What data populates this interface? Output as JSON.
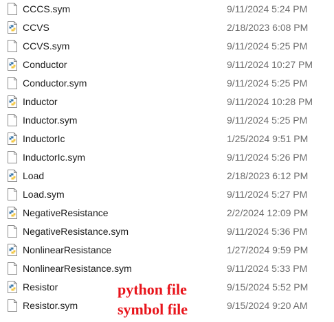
{
  "files": [
    {
      "name": "CCCS.sym",
      "modified": "9/11/2024 5:24 PM",
      "icon": "document-icon"
    },
    {
      "name": "CCVS",
      "modified": "2/18/2023 6:08 PM",
      "icon": "python-file-icon"
    },
    {
      "name": "CCVS.sym",
      "modified": "9/11/2024 5:25 PM",
      "icon": "document-icon"
    },
    {
      "name": "Conductor",
      "modified": "9/11/2024 10:27 PM",
      "icon": "python-file-icon"
    },
    {
      "name": "Conductor.sym",
      "modified": "9/11/2024 5:25 PM",
      "icon": "document-icon"
    },
    {
      "name": "Inductor",
      "modified": "9/11/2024 10:28 PM",
      "icon": "python-file-icon"
    },
    {
      "name": "Inductor.sym",
      "modified": "9/11/2024 5:25 PM",
      "icon": "document-icon"
    },
    {
      "name": "InductorIc",
      "modified": "1/25/2024 9:51 PM",
      "icon": "python-file-icon"
    },
    {
      "name": "InductorIc.sym",
      "modified": "9/11/2024 5:26 PM",
      "icon": "document-icon"
    },
    {
      "name": "Load",
      "modified": "2/18/2023 6:12 PM",
      "icon": "python-file-icon"
    },
    {
      "name": "Load.sym",
      "modified": "9/11/2024 5:27 PM",
      "icon": "document-icon"
    },
    {
      "name": "NegativeResistance",
      "modified": "2/2/2024 12:09 PM",
      "icon": "python-file-icon"
    },
    {
      "name": "NegativeResistance.sym",
      "modified": "9/11/2024 5:36 PM",
      "icon": "document-icon"
    },
    {
      "name": "NonlinearResistance",
      "modified": "1/27/2024 9:59 PM",
      "icon": "python-file-icon"
    },
    {
      "name": "NonlinearResistance.sym",
      "modified": "9/11/2024 5:33 PM",
      "icon": "document-icon"
    },
    {
      "name": "Resistor",
      "modified": "9/15/2024 5:52 PM",
      "icon": "python-file-icon"
    },
    {
      "name": "Resistor.sym",
      "modified": "9/15/2024 9:20 AM",
      "icon": "document-icon"
    }
  ],
  "annotations": {
    "python_label": "python file",
    "symbol_label": "symbol file",
    "color": "#e8141b"
  },
  "colors": {
    "filename": "#1a1a1a",
    "date": "#6d6d6d",
    "python_blue": "#3b77a8",
    "python_yellow": "#f2c53d"
  }
}
